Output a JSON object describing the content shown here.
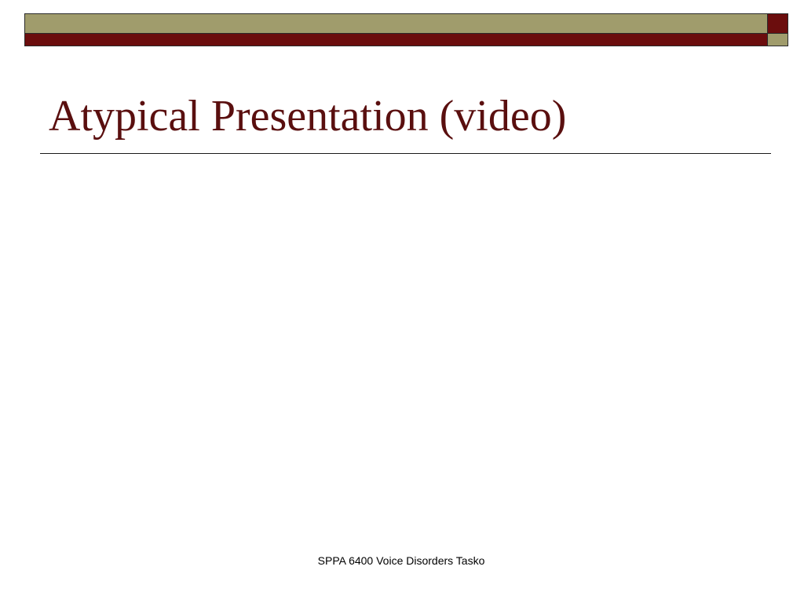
{
  "slide": {
    "title": "Atypical Presentation (video)",
    "footer": "SPPA 6400 Voice Disorders Tasko"
  },
  "colors": {
    "olive": "#a09c6c",
    "maroon": "#6b0d0d",
    "title_text": "#5a0f0f",
    "rule": "#1a1a1a",
    "background": "#ffffff"
  }
}
